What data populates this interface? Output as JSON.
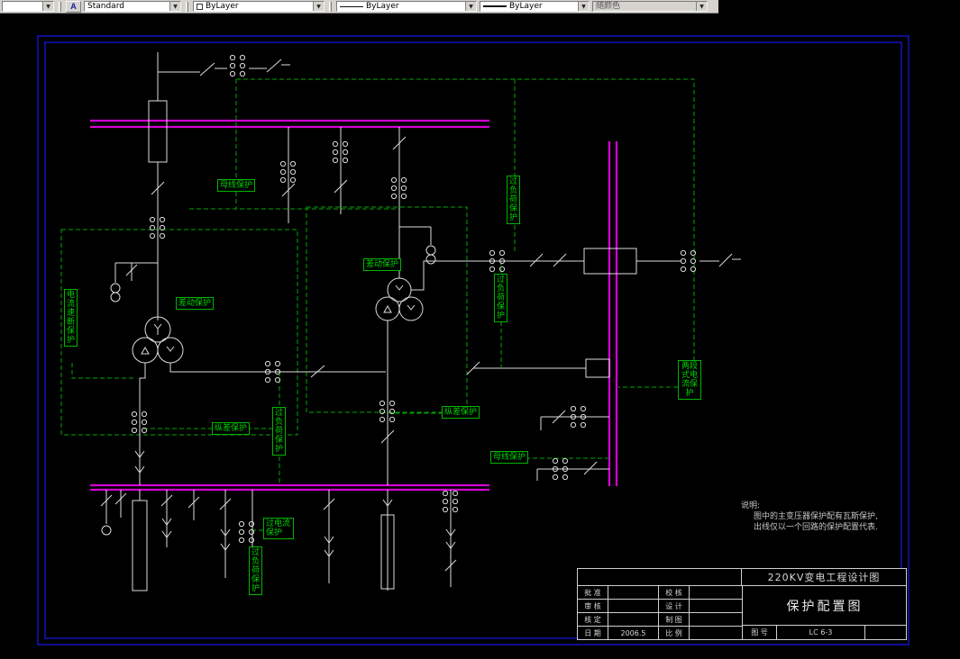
{
  "icons": {
    "dropdown": "▼",
    "text_style_button": "A"
  },
  "toolbar": {
    "left_value": "",
    "standard": "Standard",
    "color": "ByLayer",
    "linetype": "ByLayer",
    "lineweight": "ByLayer",
    "plot_style": "随颜色"
  },
  "diagram": {
    "labels": {
      "busbar_top": "母线保护",
      "overload_top": "过负荷保护",
      "diff_right": "差动保护",
      "diff_left": "差动保护",
      "current_cutoff": "电流速断保护",
      "long_diff_left": "纵差保护",
      "overload_left": "过负荷保护",
      "long_diff_right": "纵差保护",
      "overload_mid": "过负荷保护",
      "busbar_bottom": "母线保护",
      "two_stage": "两段式电流保护",
      "overcurrent": "过电流保护",
      "overload_bottom": "过负荷保护"
    },
    "notes": {
      "heading": "说明:",
      "line1": "图中的主变压器保护配有瓦斯保护,",
      "line2": "出线仅以一个回路的保护配置代表."
    }
  },
  "titleblock": {
    "project": "220KV变电工程设计图",
    "drawing": "保护配置图",
    "cells": {
      "r1c1": "批 准",
      "r1c2": "",
      "r1c3": "校 核",
      "r1c4": "",
      "r2c1": "审 核",
      "r2c2": "",
      "r2c3": "设 计",
      "r2c4": "",
      "r3c1": "核 定",
      "r3c2": "",
      "r3c3": "制 图",
      "r3c4": "",
      "r4c1": "日 期",
      "r4c2": "2006.5",
      "r4c3": "比 例",
      "r4c4": ""
    },
    "no_label": "图 号",
    "no_value": "LC 6-3"
  }
}
